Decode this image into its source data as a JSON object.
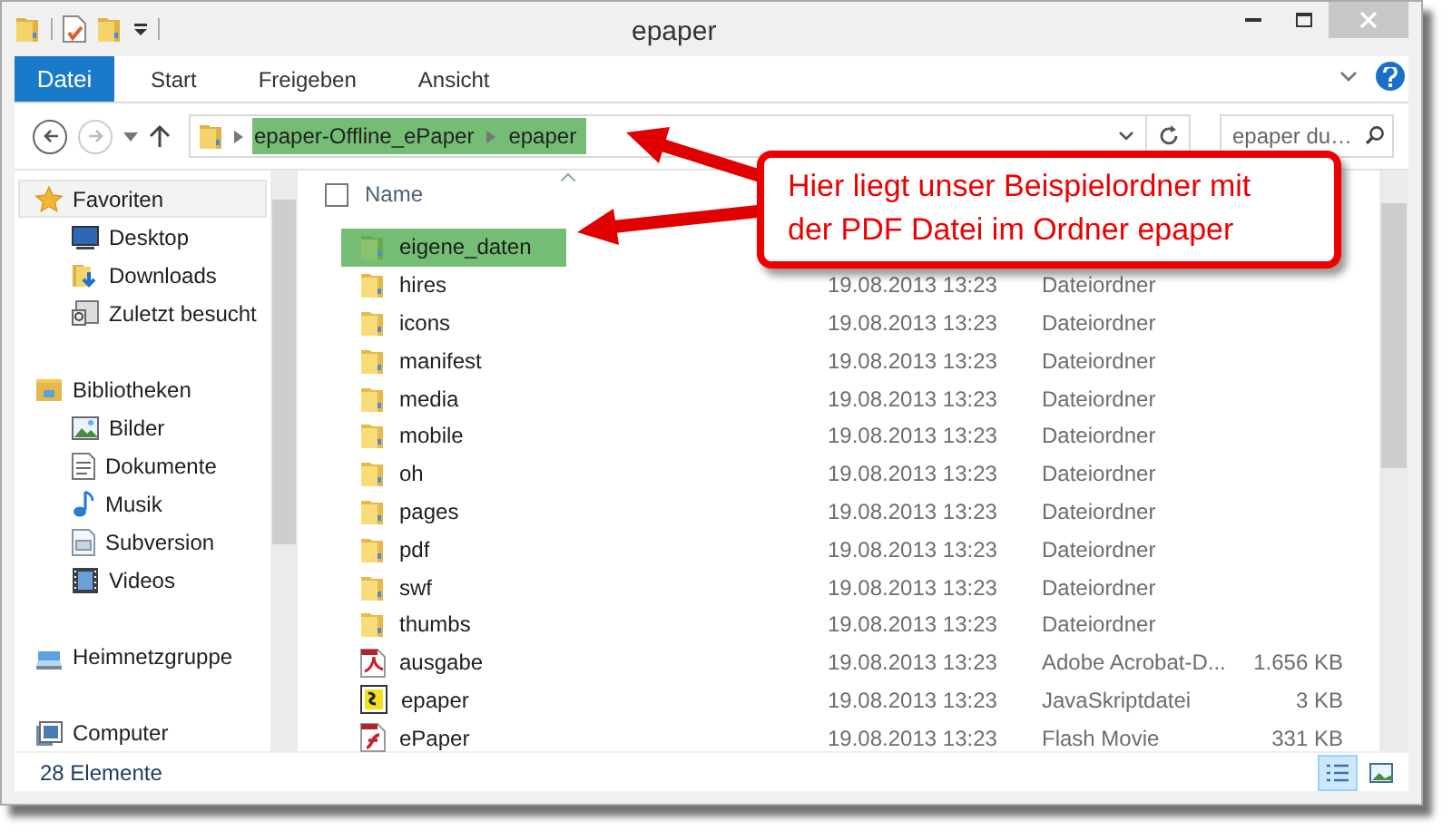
{
  "window": {
    "title": "epaper"
  },
  "ribbon_tabs": [
    {
      "label": "Datei",
      "kind": "file"
    },
    {
      "label": "Start",
      "kind": "tab"
    },
    {
      "label": "Freigeben",
      "kind": "tab"
    },
    {
      "label": "Ansicht",
      "kind": "tab"
    }
  ],
  "address": {
    "highlighted": true,
    "breadcrumbs": [
      "epaper-Offline_ePaper",
      "epaper"
    ]
  },
  "search": {
    "placeholder": "epaper du…"
  },
  "sidebar": {
    "items": [
      {
        "label": "Favoriten",
        "selected": true,
        "children": [
          {
            "label": "Desktop",
            "selected": false
          },
          {
            "label": "Downloads",
            "selected": false
          },
          {
            "label": "Zuletzt besucht",
            "selected": false
          }
        ]
      },
      {
        "label": "Bibliotheken",
        "selected": false,
        "children": [
          {
            "label": "Bilder",
            "selected": false
          },
          {
            "label": "Dokumente",
            "selected": false
          },
          {
            "label": "Musik",
            "selected": false
          },
          {
            "label": "Subversion",
            "selected": false
          },
          {
            "label": "Videos",
            "selected": false
          }
        ]
      },
      {
        "label": "Heimnetzgruppe",
        "selected": false
      },
      {
        "label": "Computer",
        "selected": false
      }
    ]
  },
  "table": {
    "select_all": {
      "checked": false
    },
    "columns": [
      "Name"
    ],
    "rows": [
      {
        "name": "eigene_daten",
        "kind": "folder",
        "highlighted": true
      },
      {
        "name": "hires",
        "kind": "folder",
        "highlighted": false,
        "date": "19.08.2013 13:23",
        "type": "Dateiordner"
      },
      {
        "name": "icons",
        "kind": "folder",
        "highlighted": false,
        "date": "19.08.2013 13:23",
        "type": "Dateiordner"
      },
      {
        "name": "manifest",
        "kind": "folder",
        "highlighted": false,
        "date": "19.08.2013 13:23",
        "type": "Dateiordner"
      },
      {
        "name": "media",
        "kind": "folder",
        "highlighted": false,
        "date": "19.08.2013 13:23",
        "type": "Dateiordner"
      },
      {
        "name": "mobile",
        "kind": "folder",
        "highlighted": false,
        "date": "19.08.2013 13:23",
        "type": "Dateiordner"
      },
      {
        "name": "oh",
        "kind": "folder",
        "highlighted": false,
        "date": "19.08.2013 13:23",
        "type": "Dateiordner"
      },
      {
        "name": "pages",
        "kind": "folder",
        "highlighted": false,
        "date": "19.08.2013 13:23",
        "type": "Dateiordner"
      },
      {
        "name": "pdf",
        "kind": "folder",
        "highlighted": false,
        "date": "19.08.2013 13:23",
        "type": "Dateiordner"
      },
      {
        "name": "swf",
        "kind": "folder",
        "highlighted": false,
        "date": "19.08.2013 13:23",
        "type": "Dateiordner"
      },
      {
        "name": "thumbs",
        "kind": "folder",
        "highlighted": false,
        "date": "19.08.2013 13:23",
        "type": "Dateiordner"
      },
      {
        "name": "ausgabe",
        "kind": "pdf",
        "highlighted": false,
        "date": "19.08.2013 13:23",
        "type": "Adobe Acrobat-D...",
        "size": "1.656 KB"
      },
      {
        "name": "epaper",
        "kind": "script",
        "highlighted": false,
        "date": "19.08.2013 13:23",
        "type": "JavaSkriptdatei",
        "size": "3 KB"
      },
      {
        "name": "ePaper",
        "kind": "flash",
        "highlighted": false,
        "date": "19.08.2013 13:23",
        "type": "Flash Movie",
        "size": "331 KB"
      }
    ]
  },
  "status_bar": {
    "text": "28 Elemente",
    "views": [
      {
        "selected": true
      },
      {
        "selected": false
      }
    ]
  },
  "callout": {
    "text": "Hier liegt unser Beispielordner mit der PDF Datei im Ordner epaper"
  }
}
